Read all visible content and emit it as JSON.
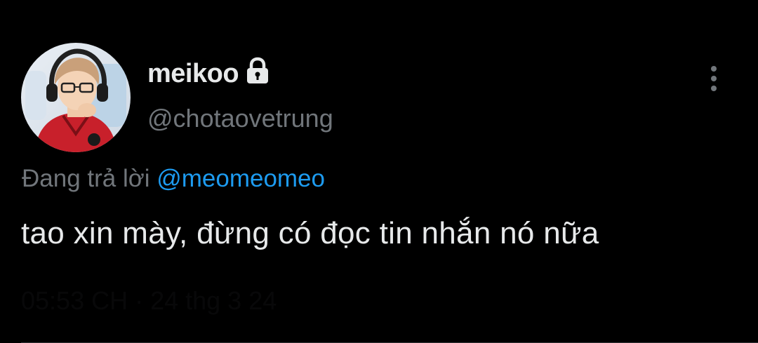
{
  "tweet": {
    "author": {
      "display_name": "meikoo",
      "handle": "@chotaovetrung",
      "protected_icon": "lock-icon",
      "avatar_icon": "avatar"
    },
    "reply": {
      "prefix": "Đang trả lời",
      "mention": "@meomeomeo"
    },
    "text": "tao xin mày, đừng có đọc tin nhắn nó nữa",
    "timestamp": "05:53 CH · 24 thg 3 24",
    "menu_icon": "more-vertical-icon"
  },
  "colors": {
    "background": "#000000",
    "primary_text": "#e7e9ea",
    "secondary_text": "#71767b",
    "accent": "#1d9bf0",
    "divider": "#2f3336"
  }
}
